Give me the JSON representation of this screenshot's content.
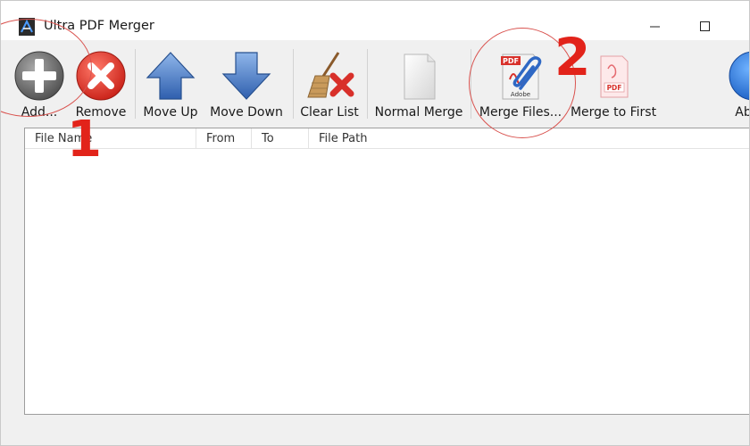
{
  "window": {
    "title": "Ultra PDF Merger"
  },
  "toolbar": {
    "add_label": "Add...",
    "remove_label": "Remove",
    "move_up_label": "Move Up",
    "move_down_label": "Move Down",
    "clear_list_label": "Clear List",
    "normal_merge_label": "Normal Merge",
    "merge_files_label": "Merge Files...",
    "merge_to_first_label": "Merge to First",
    "about_label": "About"
  },
  "icons": {
    "pdf_tag": "PDF",
    "adobe_tag": "Adobe"
  },
  "file_list": {
    "columns": [
      "File Name",
      "From",
      "To",
      "File Path"
    ],
    "rows": []
  },
  "annotations": {
    "step1": "1",
    "step2": "2"
  },
  "colors": {
    "annotation_red": "#e2231a",
    "add_gray": "#6e6e6e",
    "remove_red": "#e0302a",
    "arrow_blue": "#3f77c4"
  }
}
